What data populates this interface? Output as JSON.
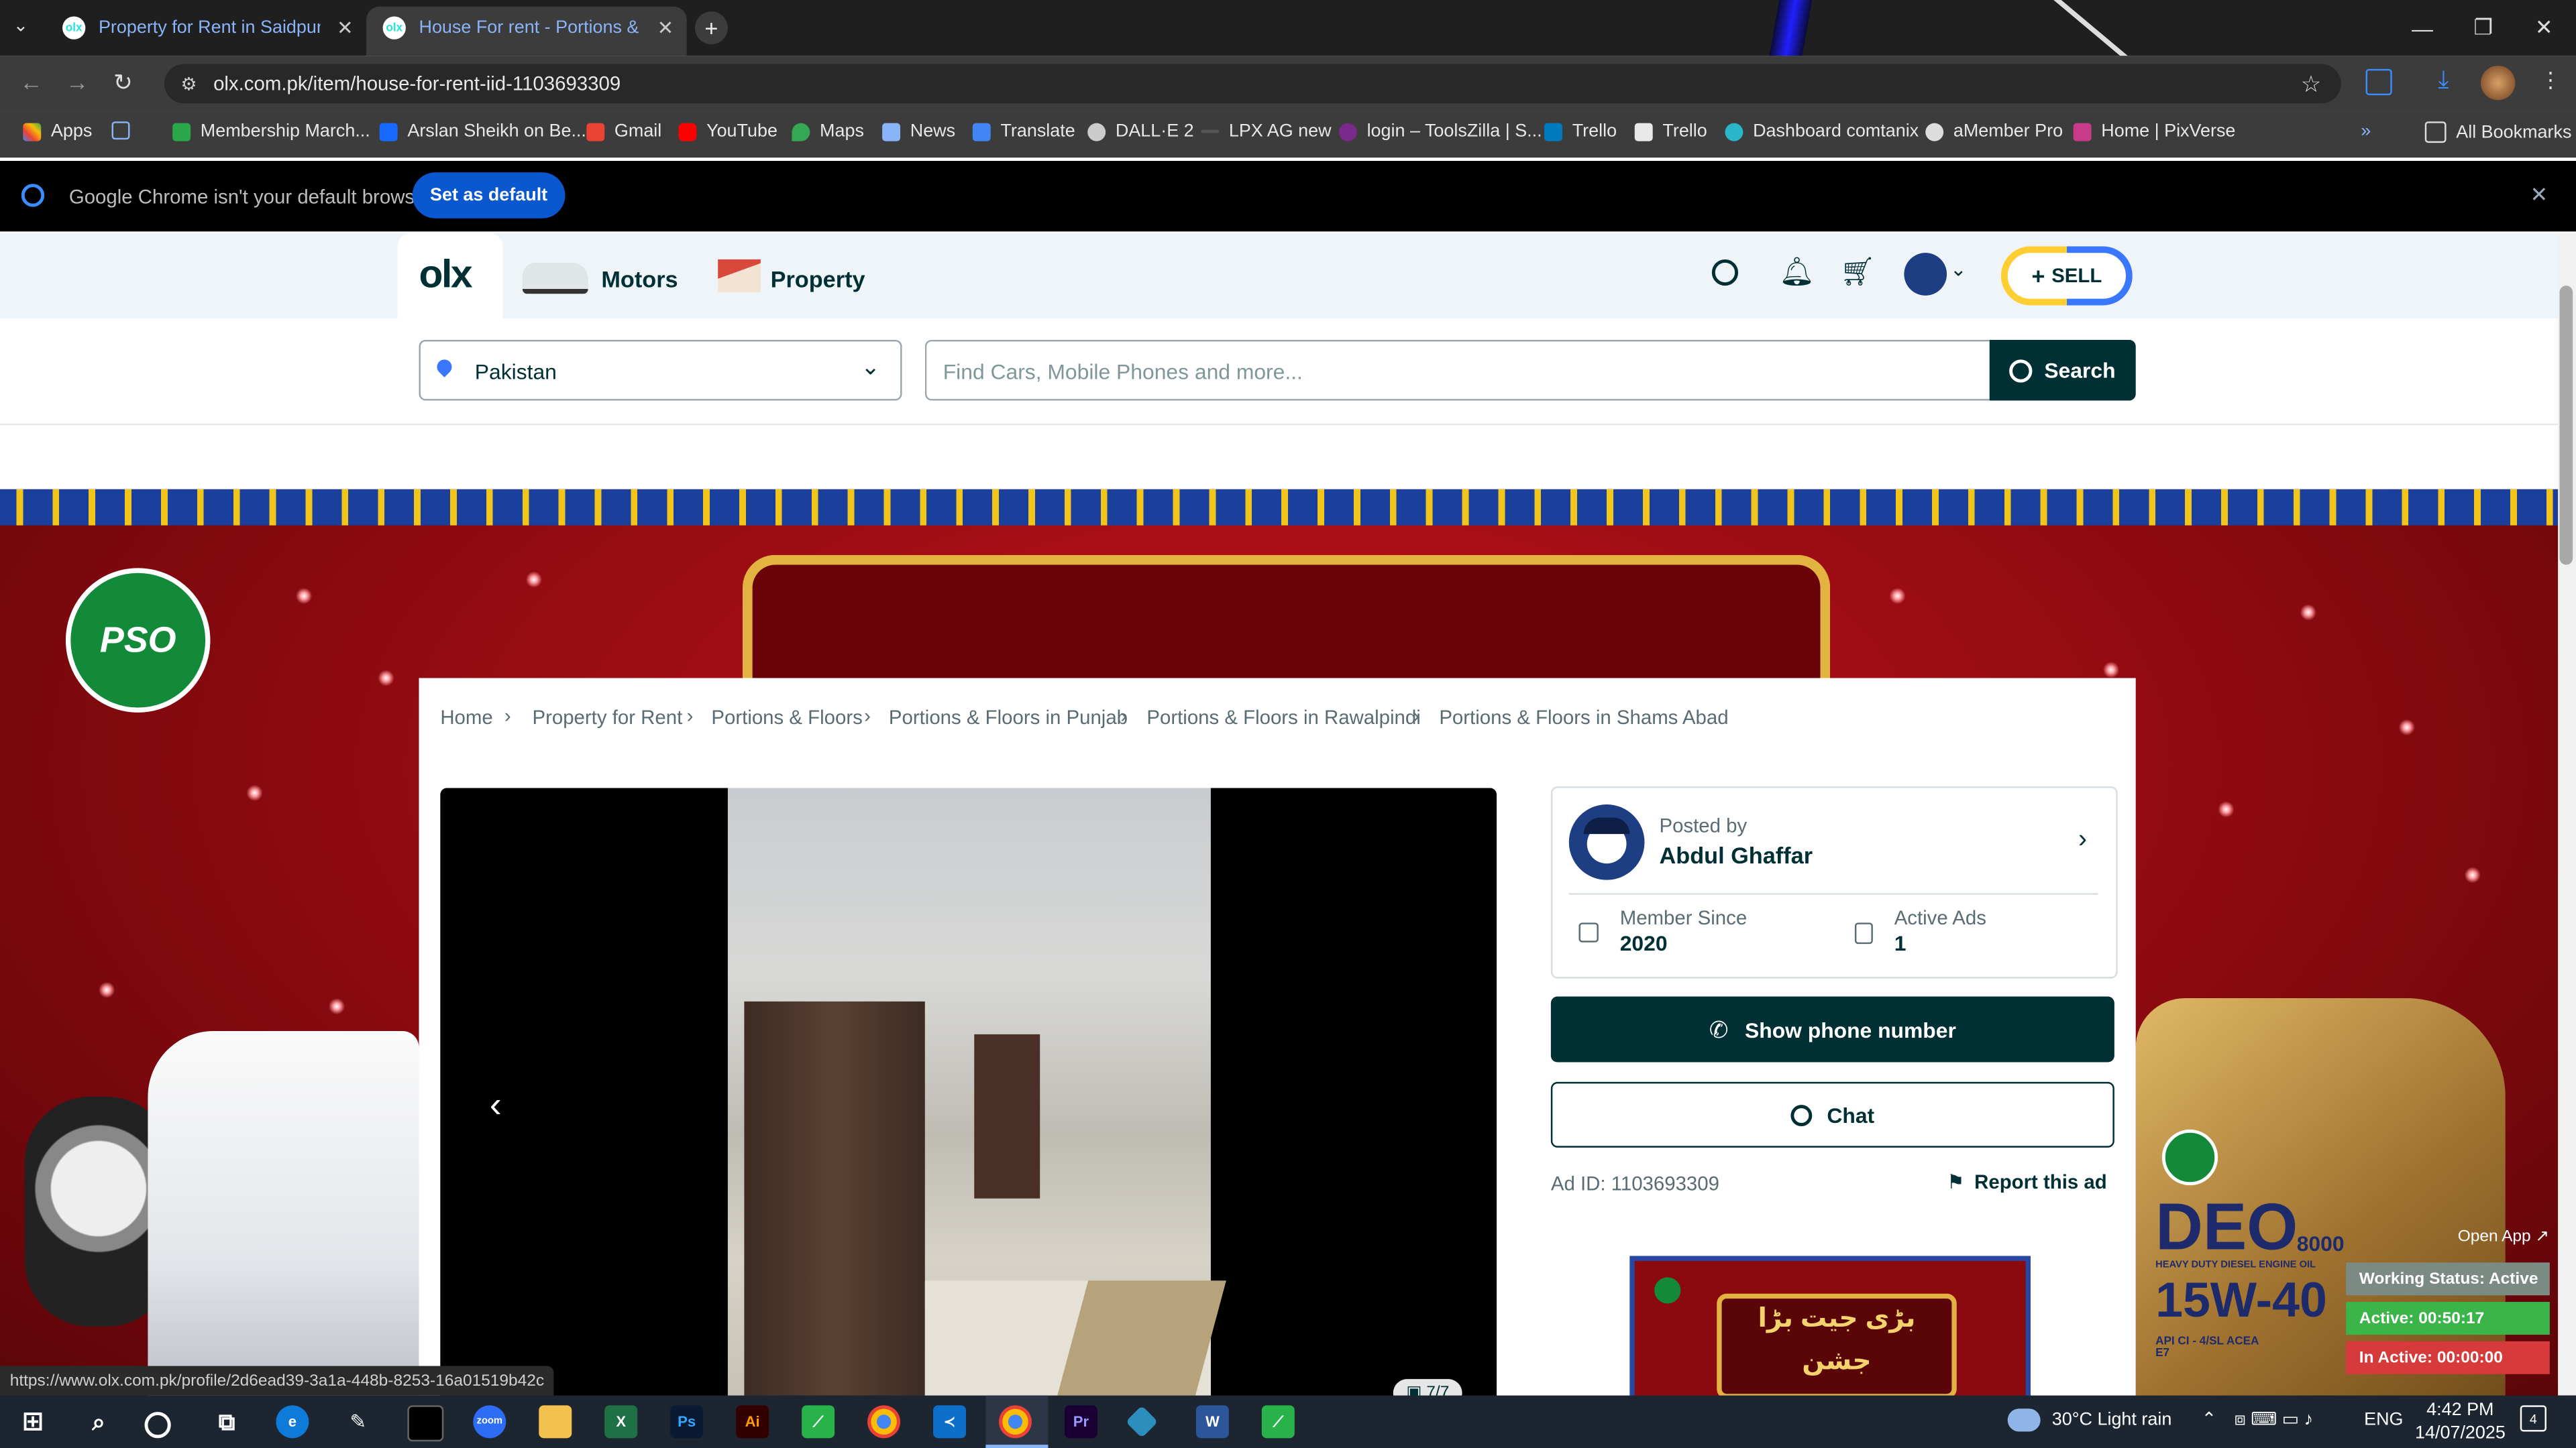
{
  "browser": {
    "tabs": [
      {
        "title": "Property for Rent in Saidpur Ro",
        "active": false
      },
      {
        "title": "House For rent - Portions & Flo",
        "active": true
      }
    ],
    "url": "olx.com.pk/item/house-for-rent-iid-1103693309",
    "bookmarks": [
      "Apps",
      "Membership March...",
      "Arslan Sheikh on Be...",
      "Gmail",
      "YouTube",
      "Maps",
      "News",
      "Translate",
      "DALL·E 2",
      "LPX AG new",
      "login – ToolsZilla | S...",
      "Trello",
      "Trello",
      "Dashboard comtanix",
      "aMember Pro",
      "Home | PixVerse"
    ],
    "all_bookmarks": "All Bookmarks",
    "default_prompt": "Google Chrome isn't your default browser",
    "set_default": "Set as default",
    "status_link": "https://www.olx.com.pk/profile/2d6ead39-3a1a-448b-8253-16a01519b42c"
  },
  "olx": {
    "logo": "olx",
    "nav": {
      "motors": "Motors",
      "property": "Property"
    },
    "sell": "SELL",
    "location": "Pakistan",
    "search_placeholder": "Find Cars, Mobile Phones and more...",
    "search_button": "Search"
  },
  "breadcrumbs": [
    "Home",
    "Property for Rent",
    "Portions & Floors",
    "Portions & Floors in Punjab",
    "Portions & Floors in Rawalpindi",
    "Portions & Floors in Shams Abad"
  ],
  "gallery": {
    "counter": "7/7"
  },
  "seller": {
    "posted_by_label": "Posted by",
    "name": "Abdul Ghaffar",
    "member_since_label": "Member Since",
    "member_since": "2020",
    "active_ads_label": "Active Ads",
    "active_ads": "1"
  },
  "actions": {
    "show_phone": "Show phone number",
    "chat": "Chat",
    "ad_id": "Ad ID: 1103693309",
    "report": "Report this ad"
  },
  "banner": {
    "brand": "PSO",
    "product": "DEO",
    "product_num": "8000",
    "product_grade": "15W-40",
    "product_sub": "HEAVY DUTY DIESEL ENGINE OIL",
    "spec": "API CI - 4/SL ACEA E7",
    "ad_text": "بڑی جیت بڑا جشن"
  },
  "tracker": {
    "open_app": "Open App ↗",
    "working": "Working Status: Active",
    "active": "Active: 00:50:17",
    "inactive": "In Active: 00:00:00"
  },
  "taskbar": {
    "weather": "30°C  Light rain",
    "lang": "ENG",
    "time": "4:42 PM",
    "date": "14/07/2025",
    "notifications": "4"
  },
  "colors": {
    "olx_dark": "#002f34",
    "olx_teal": "#23e5db",
    "sell_yellow": "#ffce32",
    "sell_blue": "#3a77ff"
  }
}
